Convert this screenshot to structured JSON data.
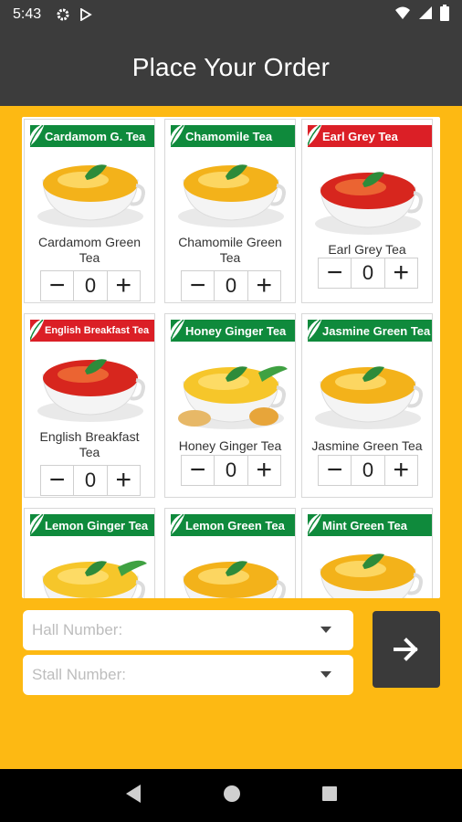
{
  "status_bar": {
    "time": "5:43",
    "icons": [
      "settings-icon",
      "play-store-icon",
      "wifi-icon",
      "signal-icon",
      "battery-icon"
    ]
  },
  "app_bar": {
    "title": "Place Your Order"
  },
  "colors": {
    "background": "#FDB913",
    "app_bar": "#3C3C3C",
    "badge_green": "#0F8A3C",
    "badge_red": "#DB1F26"
  },
  "teas": [
    {
      "badge": "Cardamom G. Tea",
      "badge_color": "green",
      "name": "Cardamom Green Tea",
      "qty": "0",
      "tea": "green"
    },
    {
      "badge": "Chamomile Tea",
      "badge_color": "green",
      "name": "Chamomile Green Tea",
      "qty": "0",
      "tea": "green"
    },
    {
      "badge": "Earl Grey Tea",
      "badge_color": "red",
      "name": "Earl Grey Tea",
      "qty": "0",
      "tea": "red"
    },
    {
      "badge": "English Breakfast Tea",
      "badge_color": "red",
      "name": "English Breakfast Tea",
      "qty": "0",
      "tea": "red"
    },
    {
      "badge": "Honey Ginger Tea",
      "badge_color": "green",
      "name": "Honey Ginger Tea",
      "qty": "0",
      "tea": "ginger"
    },
    {
      "badge": "Jasmine Green Tea",
      "badge_color": "green",
      "name": "Jasmine Green Tea",
      "qty": "0",
      "tea": "green"
    },
    {
      "badge": "Lemon Ginger Tea",
      "badge_color": "green",
      "name": "",
      "qty": "",
      "tea": "ginger"
    },
    {
      "badge": "Lemon Green Tea",
      "badge_color": "green",
      "name": "",
      "qty": "",
      "tea": "green"
    },
    {
      "badge": "Mint Green Tea",
      "badge_color": "green",
      "name": "",
      "qty": "",
      "tea": "green"
    }
  ],
  "stepper": {
    "minus": "−",
    "plus": "+"
  },
  "form": {
    "hall_placeholder": "Hall Number:",
    "stall_placeholder": "Stall Number:"
  },
  "nav_bar": {
    "icons": [
      "back-icon",
      "home-icon",
      "recents-icon"
    ]
  }
}
